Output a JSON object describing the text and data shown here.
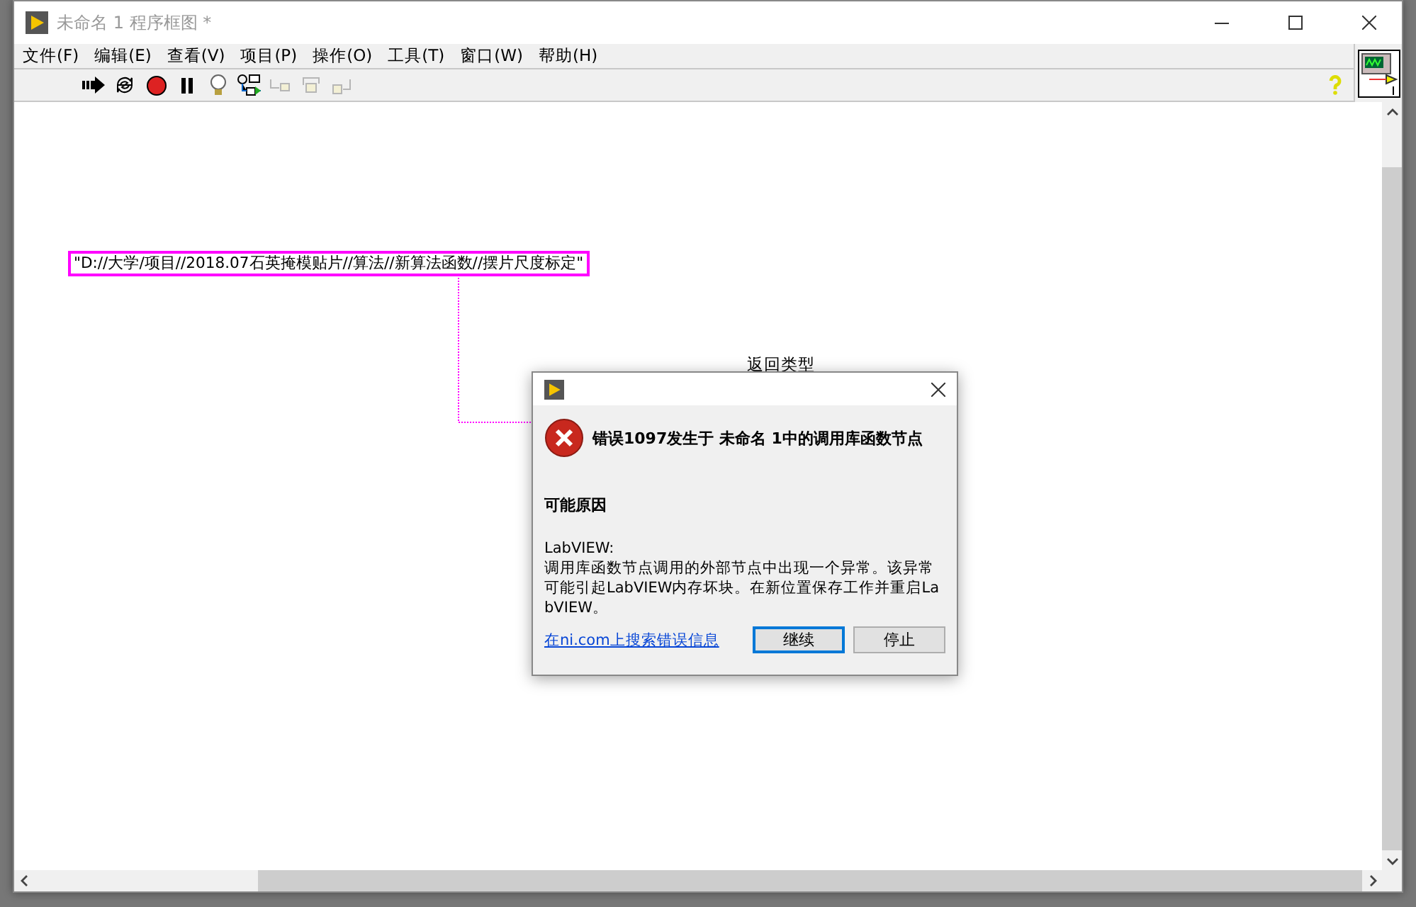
{
  "window": {
    "title": "未命名 1 程序框图 *"
  },
  "menu": [
    {
      "label": "文件(F)"
    },
    {
      "label": "编辑(E)"
    },
    {
      "label": "查看(V)"
    },
    {
      "label": "项目(P)"
    },
    {
      "label": "操作(O)"
    },
    {
      "label": "工具(T)"
    },
    {
      "label": "窗口(W)"
    },
    {
      "label": "帮助(H)"
    }
  ],
  "toolbar": [
    {
      "kind": "run",
      "disabled": false
    },
    {
      "kind": "run-continuously",
      "disabled": false
    },
    {
      "kind": "abort",
      "disabled": false
    },
    {
      "kind": "pause",
      "disabled": false
    },
    {
      "kind": "highlight",
      "disabled": false
    },
    {
      "kind": "retain",
      "disabled": false
    },
    {
      "kind": "step-into",
      "disabled": true
    },
    {
      "kind": "step-over",
      "disabled": true
    },
    {
      "kind": "step-out",
      "disabled": true
    }
  ],
  "diagram": {
    "string_constant": "\"D://大学/项目//2018.07石英掩模贴片//算法//新算法函数//摆片尺度标定\"",
    "label": "返回类型"
  },
  "dialog": {
    "heading": "错误1097发生于 未命名 1中的调用库函数节点",
    "section": "可能原因",
    "body": [
      "LabVIEW:",
      "调用库函数节点调用的外部节点中出现一个异常。该异常",
      "可能引起LabVIEW内存坏块。在新位置保存工作并重启La",
      "bVIEW。"
    ],
    "link": "在ni.com上搜索错误信息",
    "buttons": [
      {
        "label": "继续",
        "selected": true
      },
      {
        "label": "停止",
        "selected": false
      }
    ]
  }
}
